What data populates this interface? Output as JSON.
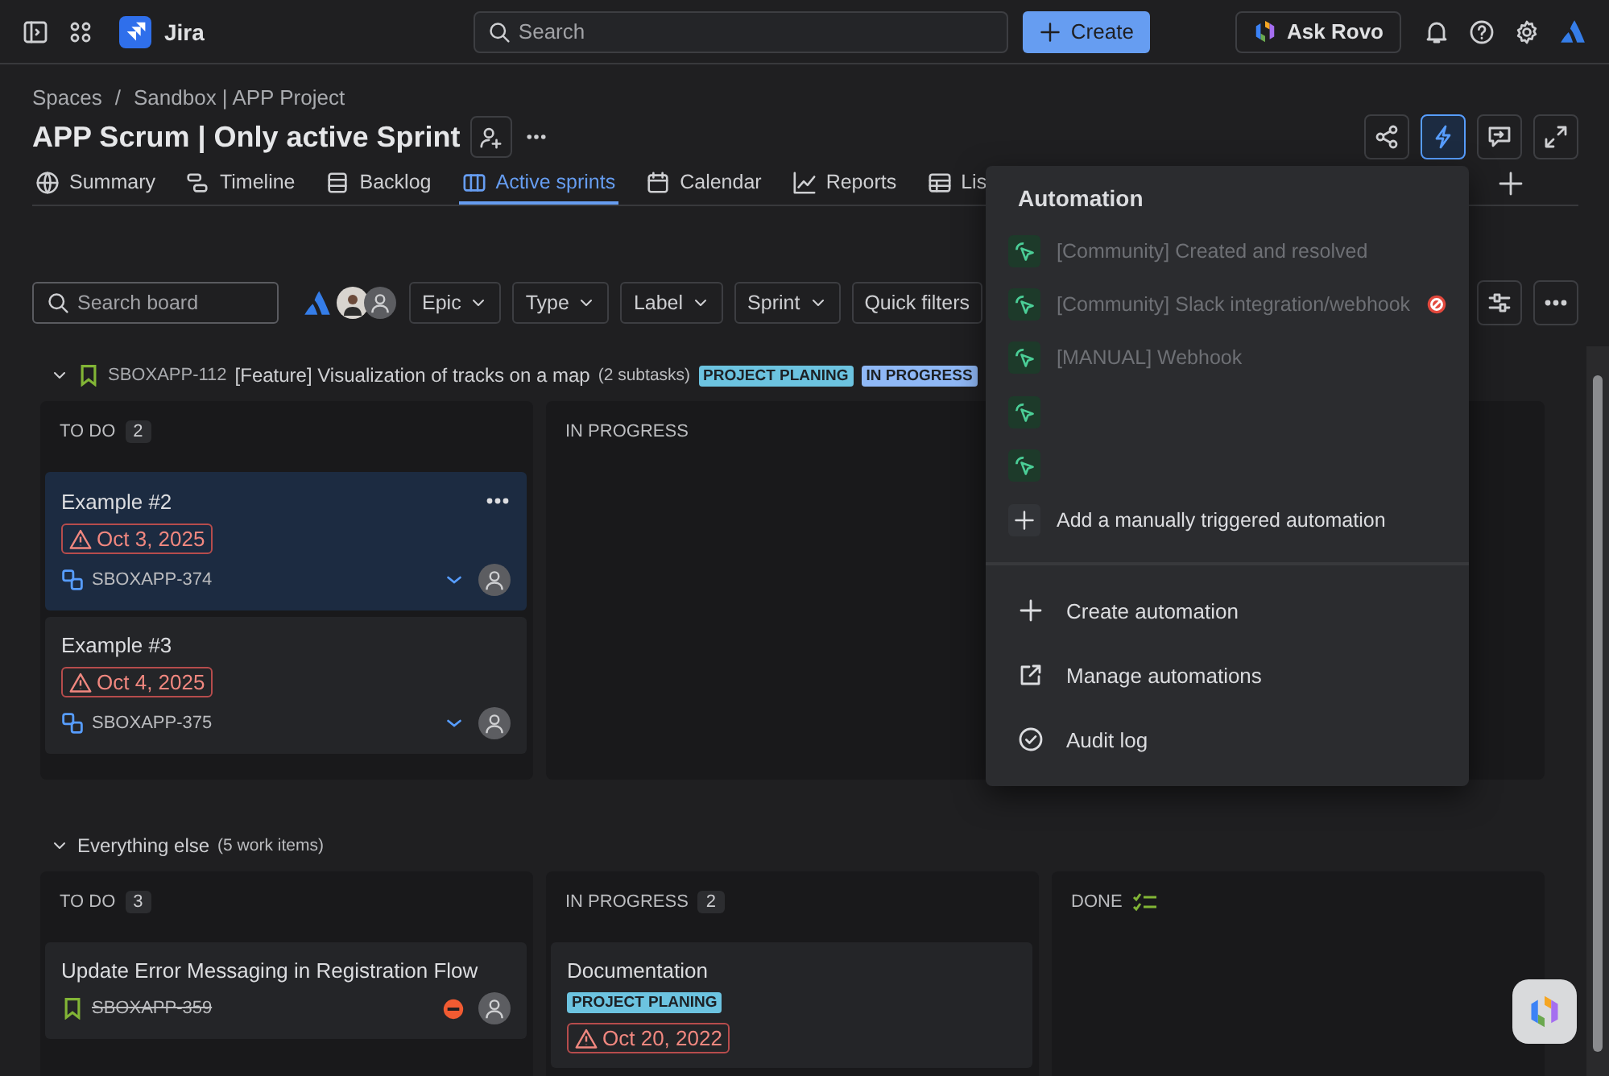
{
  "topbar": {
    "product": "Jira",
    "search": {
      "placeholder": "Search"
    },
    "create": "Create",
    "ask_rovo": "Ask Rovo"
  },
  "breadcrumbs": {
    "items": [
      "Spaces",
      "Sandbox | APP Project"
    ],
    "separator": "/"
  },
  "title": "APP Scrum | Only active Sprint",
  "header_actions": [
    {
      "kind": "share",
      "selected": false
    },
    {
      "kind": "automation",
      "selected": true
    },
    {
      "kind": "feedback",
      "selected": false
    },
    {
      "kind": "fullscreen",
      "selected": false
    }
  ],
  "tabs": [
    {
      "kind": "summary",
      "label": "Summary",
      "selected": false
    },
    {
      "kind": "timeline",
      "label": "Timeline",
      "selected": false
    },
    {
      "kind": "backlog",
      "label": "Backlog",
      "selected": false
    },
    {
      "kind": "board",
      "label": "Active sprints",
      "selected": true
    },
    {
      "kind": "calendar",
      "label": "Calendar",
      "selected": false
    },
    {
      "kind": "reports",
      "label": "Reports",
      "selected": false
    },
    {
      "kind": "list",
      "label": "Lis",
      "selected": false
    }
  ],
  "filters": {
    "search": {
      "placeholder": "Search board"
    },
    "dropdowns": [
      "Epic",
      "Type",
      "Label",
      "Sprint"
    ],
    "quick_filters": "Quick filters"
  },
  "swimlanes": [
    {
      "kind": "story",
      "key": "SBOXAPP-112",
      "title": "[Feature] Visualization of tracks on a map",
      "count": "(2 subtasks)",
      "expanded": true,
      "tags": [
        {
          "label": "PROJECT PLANING",
          "color": "#6cc3e0"
        },
        {
          "label": "IN PROGRESS",
          "color": "#8fb8f6"
        }
      ],
      "columns": [
        {
          "kind": "todo",
          "name": "TO DO",
          "count": "2",
          "cards": [
            {
              "kind": "subtask",
              "title": "Example #2",
              "selected": true,
              "due": "Oct 3, 2025",
              "key": "SBOXAPP-374",
              "done": false,
              "blocked": false
            },
            {
              "kind": "subtask",
              "title": "Example #3",
              "selected": false,
              "due": "Oct 4, 2025",
              "key": "SBOXAPP-375",
              "done": false,
              "blocked": false
            }
          ]
        },
        {
          "kind": "in_progress",
          "name": "IN PROGRESS"
        }
      ]
    },
    {
      "kind": "group",
      "title": "Everything else",
      "count": "(5 work items)",
      "expanded": true,
      "columns": [
        {
          "kind": "todo",
          "name": "TO DO",
          "count": "3",
          "cards": [
            {
              "kind": "story",
              "title": "Update Error Messaging in Registration Flow",
              "selected": false,
              "key": "SBOXAPP-359",
              "done": true,
              "blocked": true
            }
          ]
        },
        {
          "kind": "in_progress",
          "name": "IN PROGRESS",
          "count": "2",
          "cards": [
            {
              "title": "Documentation",
              "selected": false,
              "tags": [
                {
                  "label": "PROJECT PLANING",
                  "color": "#6cc3e0"
                }
              ],
              "due": "Oct 20, 2022"
            }
          ]
        },
        {
          "kind": "done",
          "name": "DONE"
        }
      ]
    }
  ],
  "menu": {
    "title": "Automation",
    "items": [
      {
        "kind": "rule",
        "label": "[Community] Created and resolved",
        "disabled": true,
        "error": false
      },
      {
        "kind": "rule",
        "label": "[Community] Slack integration/webhook",
        "disabled": true,
        "error": true
      },
      {
        "kind": "rule",
        "label": "[MANUAL] Webhook",
        "disabled": true,
        "error": false
      },
      {
        "kind": "rule",
        "error": false
      },
      {
        "kind": "rule",
        "error": false
      },
      {
        "kind": "add",
        "label": "Add a manually triggered automation"
      }
    ],
    "actions": [
      {
        "kind": "create",
        "label": "Create automation"
      },
      {
        "kind": "manage",
        "label": "Manage automations"
      },
      {
        "kind": "audit",
        "label": "Audit log"
      }
    ]
  }
}
